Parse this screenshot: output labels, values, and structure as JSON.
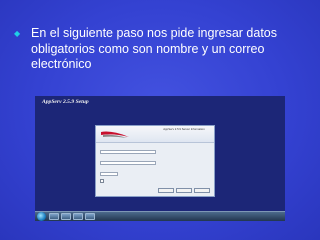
{
  "slide": {
    "bullet_text": "En el siguiente paso nos pide ingresar datos obligatorios como son nombre y un correo electrónico",
    "bullet_icon": "diamond-bullet-icon",
    "colors": {
      "background": "#3442d2",
      "bullet": "#1fd0e6",
      "text": "#ffffff"
    }
  },
  "screenshot": {
    "setup_title": "AppServ 2.5.9 Setup",
    "dialog": {
      "title": "AppServ 2.5.9 Server Information"
    },
    "taskbar": {
      "start_icon": "windows-start-icon",
      "clock_time": "",
      "clock_date": ""
    }
  }
}
